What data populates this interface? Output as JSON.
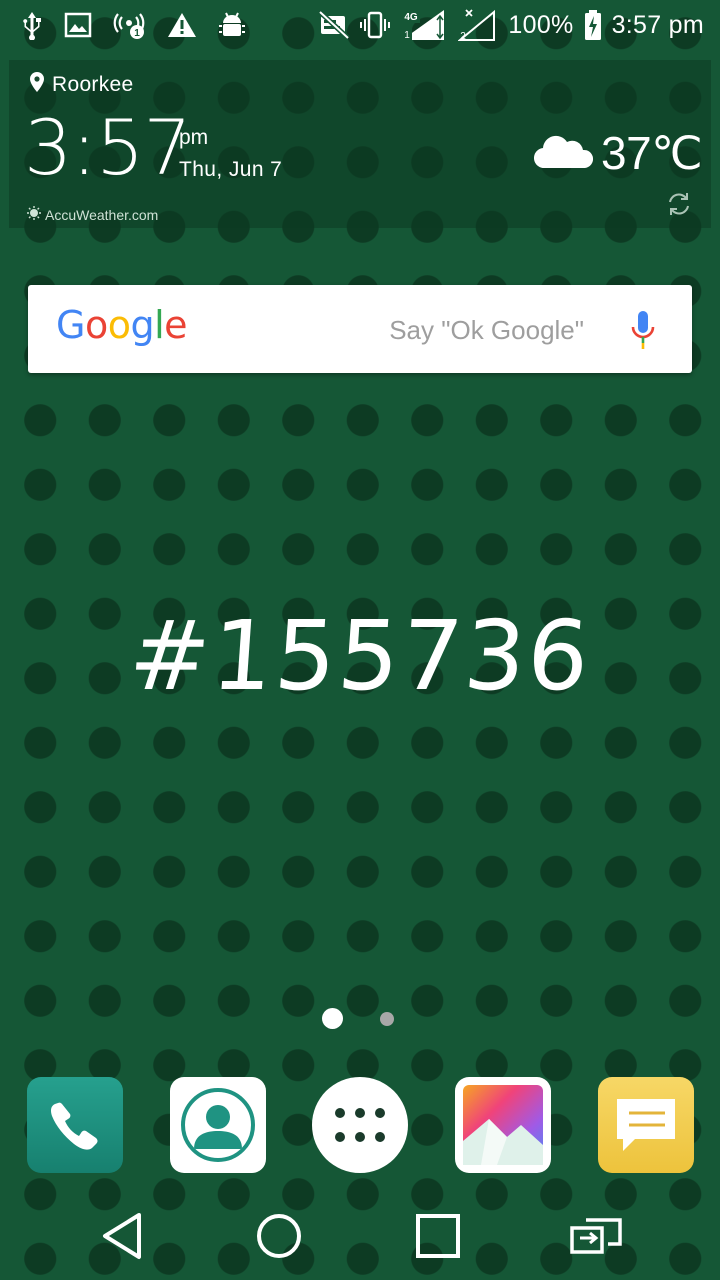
{
  "status_bar": {
    "battery": "100%",
    "time": "3:57 pm",
    "network": "4G",
    "sim1": "1",
    "sim2": "2",
    "hotspot_badge": "1"
  },
  "weather_widget": {
    "location": "Roorkee",
    "time": "3:57",
    "ampm": "pm",
    "date": "Thu, Jun 7",
    "temperature": "37℃",
    "provider": "AccuWeather.com"
  },
  "search": {
    "logo": "Google",
    "hint": "Say \"Ok Google\""
  },
  "wallpaper": {
    "label": "#155736",
    "background_color": "#155736",
    "dot_color": "#0d3b23"
  },
  "page_indicator": {
    "total": 2,
    "active": 1
  },
  "dock": {
    "apps": [
      "phone",
      "contacts",
      "app-drawer",
      "photos",
      "messages"
    ]
  },
  "navigation": {
    "buttons": [
      "back",
      "home",
      "recents",
      "switch"
    ]
  },
  "colors": {
    "google_blue": "#4285F4",
    "google_red": "#EA4335",
    "google_yellow": "#FBBC05",
    "google_green": "#34A853",
    "phone_app": "#1f9382",
    "messages_app": "#f2cb4f"
  }
}
